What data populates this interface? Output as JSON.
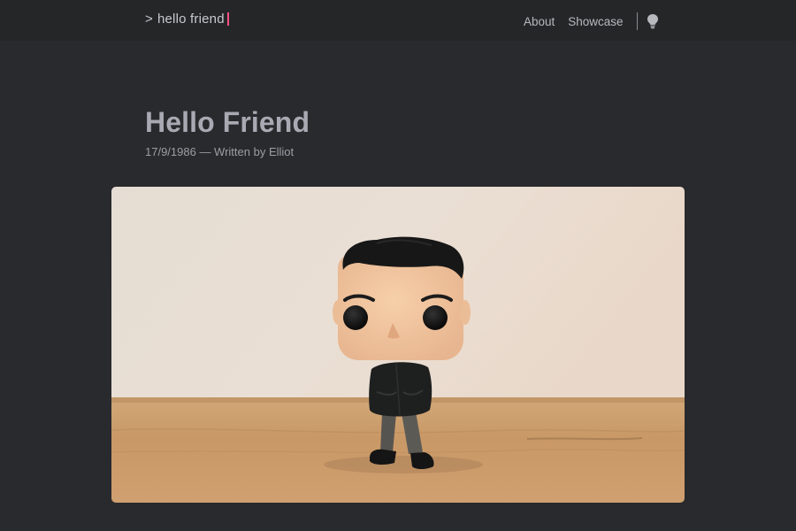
{
  "header": {
    "logo": {
      "prompt": ">",
      "text": "hello friend",
      "cursor_color": "#fe5186"
    },
    "menu": [
      {
        "label": "About"
      },
      {
        "label": "Showcase"
      }
    ],
    "theme_toggle_icon": "lightbulb-icon"
  },
  "post": {
    "title": "Hello Friend",
    "meta": "17/9/1986 — Written by Elliot",
    "cover_image": "figure-photo"
  },
  "colors": {
    "background": "#292a2d",
    "header_background": "#252627",
    "text": "#a9a9b3",
    "accent": "#fe5186"
  }
}
